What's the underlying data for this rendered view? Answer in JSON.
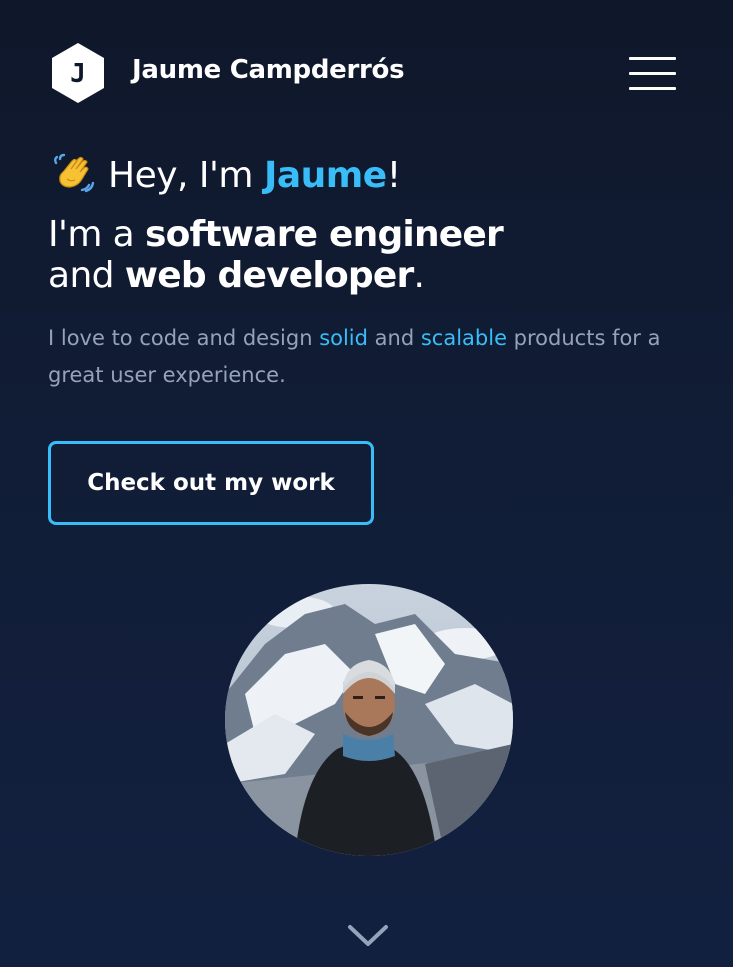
{
  "header": {
    "logo_letter": "J",
    "site_name": "Jaume Campderrós",
    "menu_icon": "hamburger-menu-icon"
  },
  "hero": {
    "greeting_emoji_icon": "waving-hand-icon",
    "greeting_prefix": "Hey, I'm ",
    "greeting_name": "Jaume",
    "greeting_suffix": "!",
    "headline_line1_prefix": "I'm a ",
    "headline_line1_bold": "software engineer",
    "headline_line2_prefix": "and ",
    "headline_line2_bold": "web developer",
    "headline_line2_suffix": ".",
    "tagline_part1": "I love to code and design ",
    "tagline_hl1": "solid",
    "tagline_part2": " and ",
    "tagline_hl2": "scalable",
    "tagline_part3": " products for a great user experience.",
    "cta_label": "Check out my work"
  },
  "avatar": {
    "description_icon": "profile-photo"
  },
  "scroll": {
    "icon": "chevron-down-icon"
  },
  "colors": {
    "background": "#0f172a",
    "accent": "#38bdf8",
    "muted_text": "#94a3b8",
    "text": "#ffffff"
  }
}
